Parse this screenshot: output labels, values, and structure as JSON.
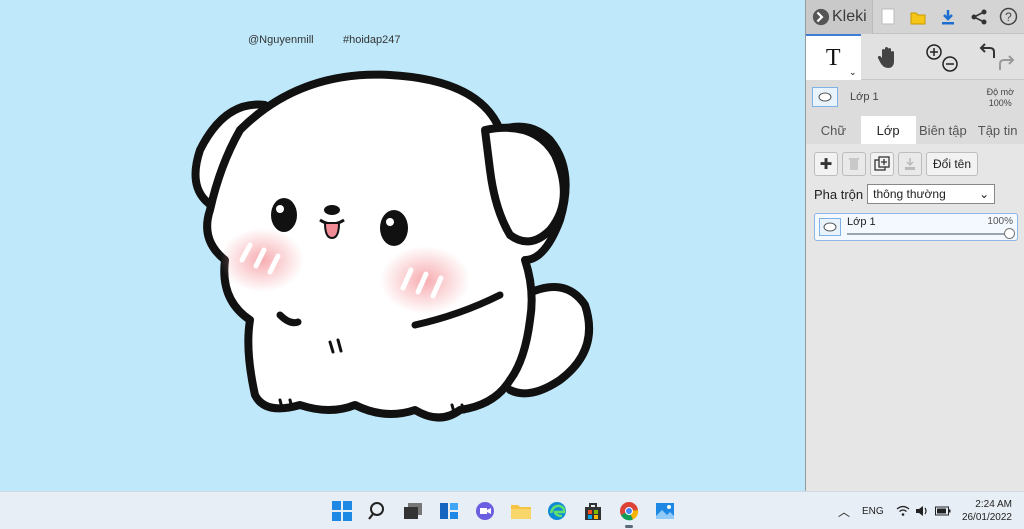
{
  "canvas": {
    "watermark_left": "@Nguyenmill",
    "watermark_right": "#hoidap247",
    "background": "#bfe9fb"
  },
  "app": {
    "brand": "Kleki",
    "icons": [
      "new-file-icon",
      "open-folder-icon",
      "download-icon",
      "share-icon",
      "help-icon"
    ]
  },
  "tools": {
    "text_tool": "T",
    "active": "text-tool"
  },
  "layer_strip": {
    "name": "Lớp 1",
    "opacity_label": "Độ mờ",
    "opacity_value": "100%"
  },
  "tabs": [
    {
      "label": "Chữ"
    },
    {
      "label": "Lớp"
    },
    {
      "label": "Biên tập"
    },
    {
      "label": "Tập tin"
    }
  ],
  "active_tab": "Lớp",
  "layers_panel": {
    "rename_label": "Đổi tên",
    "blend_label": "Pha trộn",
    "blend_value": "thông thường",
    "layer": {
      "name": "Lớp 1",
      "opacity": "100%"
    }
  },
  "taskbar": {
    "lang": "ENG",
    "time": "2:24 AM",
    "date": "26/01/2022"
  }
}
